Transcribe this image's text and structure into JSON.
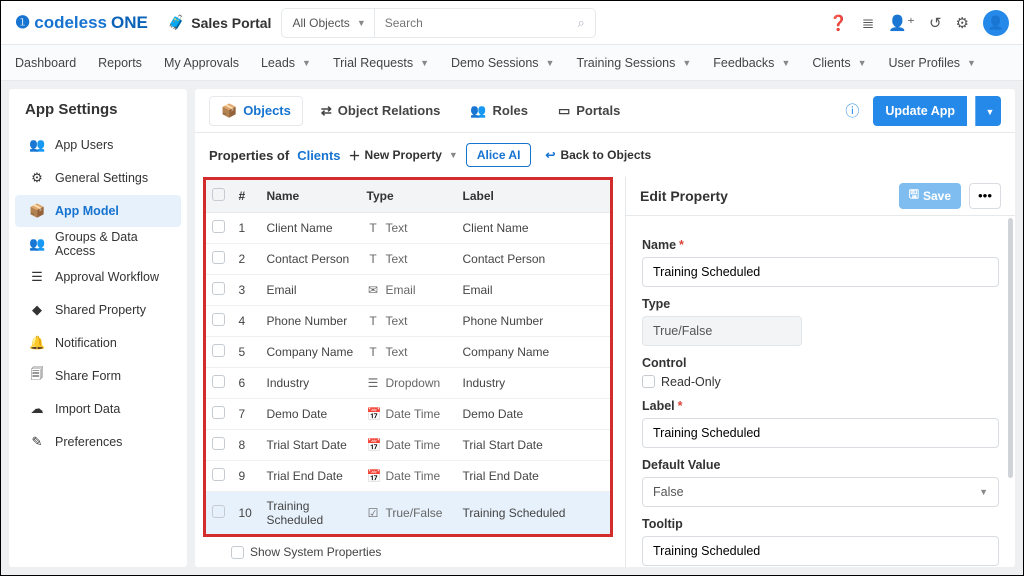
{
  "topbar": {
    "logo_main": "codeless",
    "logo_suffix": "ONE",
    "portal_label": "Sales Portal",
    "allobjects_label": "All Objects",
    "search_placeholder": "Search"
  },
  "nav": {
    "items": [
      "Dashboard",
      "Reports",
      "My Approvals",
      "Leads",
      "Trial Requests",
      "Demo Sessions",
      "Training Sessions",
      "Feedbacks",
      "Clients",
      "User Profiles"
    ],
    "dropdowns": [
      false,
      false,
      false,
      true,
      true,
      true,
      true,
      true,
      true,
      true
    ]
  },
  "sidebar": {
    "title": "App Settings",
    "items": [
      {
        "label": "App Users",
        "icon": "👥"
      },
      {
        "label": "General Settings",
        "icon": "⚙"
      },
      {
        "label": "App Model",
        "icon": "📦",
        "active": true
      },
      {
        "label": "Groups & Data Access",
        "icon": "👥"
      },
      {
        "label": "Approval Workflow",
        "icon": "☰"
      },
      {
        "label": "Shared Property",
        "icon": "◆"
      },
      {
        "label": "Notification",
        "icon": "🔔"
      },
      {
        "label": "Share Form",
        "icon": "🗐"
      },
      {
        "label": "Import Data",
        "icon": "☁"
      },
      {
        "label": "Preferences",
        "icon": "✎"
      }
    ]
  },
  "tabs": {
    "items": [
      {
        "label": "Objects",
        "active": true,
        "icon": "📦"
      },
      {
        "label": "Object Relations",
        "icon": "⇄"
      },
      {
        "label": "Roles",
        "icon": "👥"
      },
      {
        "label": "Portals",
        "icon": "▭"
      }
    ],
    "update_label": "Update App"
  },
  "props_header": {
    "prefix": "Properties of",
    "object": "Clients",
    "new_property": "New Property",
    "alice": "Alice AI",
    "back": "Back to Objects"
  },
  "table": {
    "headers": {
      "num": "#",
      "name": "Name",
      "type": "Type",
      "label": "Label"
    },
    "rows": [
      {
        "n": "1",
        "name": "Client Name",
        "type": "Text",
        "label": "Client Name",
        "icon": "T"
      },
      {
        "n": "2",
        "name": "Contact Person",
        "type": "Text",
        "label": "Contact Person",
        "icon": "T"
      },
      {
        "n": "3",
        "name": "Email",
        "type": "Email",
        "label": "Email",
        "icon": "✉"
      },
      {
        "n": "4",
        "name": "Phone Number",
        "type": "Text",
        "label": "Phone Number",
        "icon": "T"
      },
      {
        "n": "5",
        "name": "Company Name",
        "type": "Text",
        "label": "Company Name",
        "icon": "T"
      },
      {
        "n": "6",
        "name": "Industry",
        "type": "Dropdown",
        "label": "Industry",
        "icon": "☰"
      },
      {
        "n": "7",
        "name": "Demo Date",
        "type": "Date Time",
        "label": "Demo Date",
        "icon": "📅"
      },
      {
        "n": "8",
        "name": "Trial Start Date",
        "type": "Date Time",
        "label": "Trial Start Date",
        "icon": "📅"
      },
      {
        "n": "9",
        "name": "Trial End Date",
        "type": "Date Time",
        "label": "Trial End Date",
        "icon": "📅"
      },
      {
        "n": "10",
        "name": "Training Scheduled",
        "type": "True/False",
        "label": "Training Scheduled",
        "icon": "☑",
        "selected": true
      }
    ],
    "show_system": "Show System Properties"
  },
  "editor": {
    "title": "Edit Property",
    "save": "Save",
    "fields": {
      "name_label": "Name",
      "name_value": "Training Scheduled",
      "type_label": "Type",
      "type_value": "True/False",
      "control_label": "Control",
      "readonly_label": "Read-Only",
      "label_label": "Label",
      "label_value": "Training Scheduled",
      "default_label": "Default Value",
      "default_value": "False",
      "tooltip_label": "Tooltip",
      "tooltip_value": "Training Scheduled"
    }
  }
}
